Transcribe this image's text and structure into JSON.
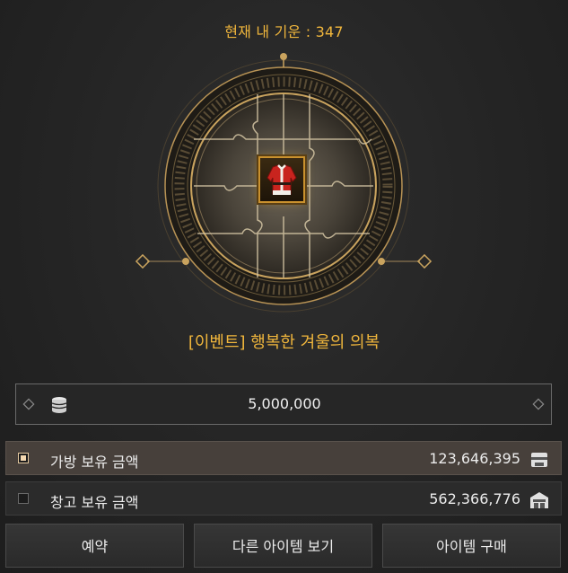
{
  "fortune_text": "현재 내 기운 : 347",
  "item_name": "[이벤트] 행복한 겨울의 의복",
  "item_icon": "red-winter-outfit-icon",
  "price": "5,000,000",
  "funds": [
    {
      "label": "가방 보유 금액",
      "amount": "123,646,395",
      "checked": true,
      "icon": "bag-icon"
    },
    {
      "label": "창고 보유 금액",
      "amount": "562,366,776",
      "checked": false,
      "icon": "warehouse-icon"
    }
  ],
  "buttons": {
    "reserve": "예약",
    "view_other": "다른 아이템 보기",
    "buy": "아이템 구매"
  },
  "colors": {
    "accent": "#f0b63c",
    "selected_row": "#47403b"
  }
}
